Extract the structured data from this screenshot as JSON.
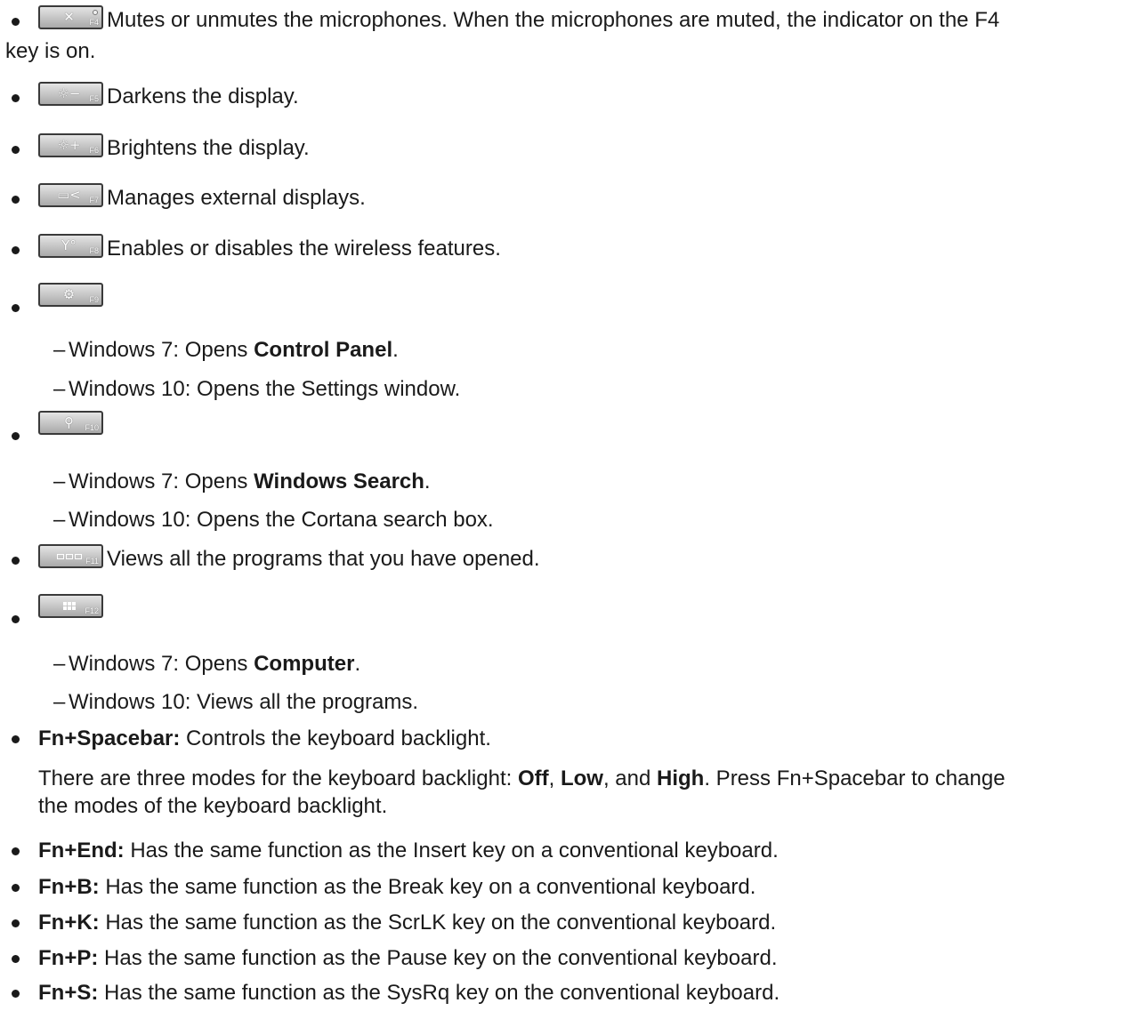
{
  "items": {
    "f4": {
      "key_label": "F4",
      "icon": "microphone-mute-icon",
      "text": "Mutes or unmutes the microphones. When the microphones are muted, the indicator on the F4",
      "text_cont": "key is on."
    },
    "f5": {
      "key_label": "F5",
      "icon": "brightness-down-icon",
      "text": "Darkens the display."
    },
    "f6": {
      "key_label": "F6",
      "icon": "brightness-up-icon",
      "text": "Brightens the display."
    },
    "f7": {
      "key_label": "F7",
      "icon": "external-display-icon",
      "text": "Manages external displays."
    },
    "f8": {
      "key_label": "F8",
      "icon": "wireless-icon",
      "text": "Enables or disables the wireless features."
    },
    "f9": {
      "key_label": "F9",
      "icon": "settings-gear-icon",
      "sub1_prefix": "Windows 7: Opens ",
      "sub1_bold": "Control Panel",
      "sub1_suffix": ".",
      "sub2": "Windows 10: Opens the Settings window."
    },
    "f10": {
      "key_label": "F10",
      "icon": "search-icon",
      "sub1_prefix": "Windows 7: Opens ",
      "sub1_bold": "Windows Search",
      "sub1_suffix": ".",
      "sub2": "Windows 10: Opens the Cortana search box."
    },
    "f11": {
      "key_label": "F11",
      "icon": "task-view-icon",
      "text": "Views all the programs that you have opened."
    },
    "f12": {
      "key_label": "F12",
      "icon": "all-programs-grid-icon",
      "sub1_prefix": "Windows 7: Opens ",
      "sub1_bold": "Computer",
      "sub1_suffix": ".",
      "sub2": "Windows 10: Views all the programs."
    },
    "fn_space": {
      "label": "Fn+Spacebar:",
      "text": " Controls the keyboard backlight.",
      "para_prefix": "There are three modes for the keyboard backlight: ",
      "mode_off": "Off",
      "sep1": ", ",
      "mode_low": "Low",
      "sep2": ", and ",
      "mode_high": "High",
      "para_suffix": ". Press Fn+Spacebar to change",
      "para_cont": "the modes of the keyboard backlight."
    },
    "fn_end": {
      "label": "Fn+End:",
      "text": " Has the same function as the Insert key on a conventional keyboard."
    },
    "fn_b": {
      "label": "Fn+B:",
      "text": " Has the same function as the Break key on a conventional keyboard."
    },
    "fn_k": {
      "label": "Fn+K:",
      "text": " Has the same function as the ScrLK key on the conventional keyboard."
    },
    "fn_p": {
      "label": "Fn+P:",
      "text": " Has the same function as the Pause key on the conventional keyboard."
    },
    "fn_s": {
      "label": "Fn+S:",
      "text": " Has the same function as the SysRq key on the conventional keyboard."
    }
  },
  "dash": "–"
}
